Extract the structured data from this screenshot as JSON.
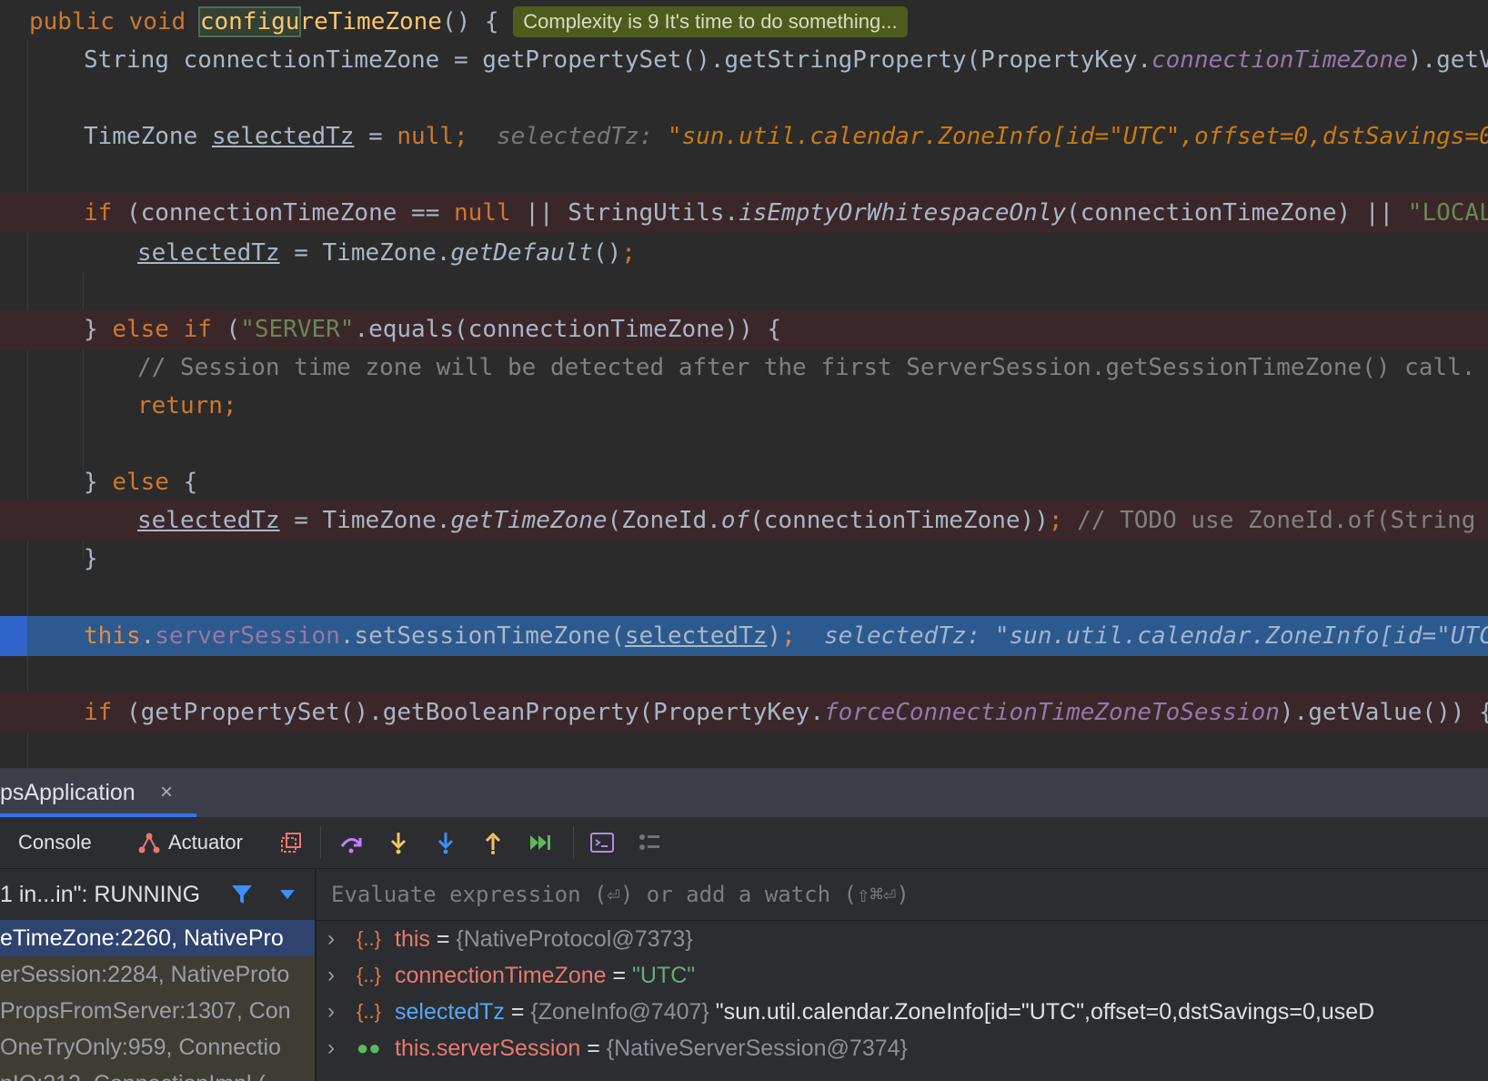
{
  "editor": {
    "complexity_badge": "Complexity is 9 It's time to do something...",
    "l1": {
      "kw": "public void ",
      "caret_word": "configu",
      "fn_rest": "reTimeZone",
      "tail": "() {"
    },
    "l2": {
      "a": "String connectionTimeZone = getPropertySet().getStringProperty(PropertyKey.",
      "fld": "connectionTimeZone",
      "b": ").getV"
    },
    "l3": {
      "a": "TimeZone ",
      "var": "selectedTz",
      "b": " = ",
      "kw": "null;",
      "hint_label": "selectedTz:",
      "hint_value": "\"sun.util.calendar.ZoneInfo[id=\"UTC\",offset=0,dstSavings=0"
    },
    "l4": {
      "kw": "if ",
      "a": "(connectionTimeZone == ",
      "kw2": "null",
      "b": " || StringUtils.",
      "st": "isEmptyOrWhitespaceOnly",
      "c": "(connectionTimeZone) || ",
      "str": "\"LOCAL"
    },
    "l5": {
      "var": "selectedTz",
      "a": " = TimeZone.",
      "st": "getDefault",
      "b": "()",
      "kw": ";"
    },
    "l6": {
      "a": "} ",
      "kw": "else if ",
      "b": "(",
      "str": "\"SERVER\"",
      "c": ".equals(connectionTimeZone)) {"
    },
    "l7": {
      "cm": "// Session time zone will be detected after the first ServerSession.getSessionTimeZone() call."
    },
    "l8": {
      "kw": "return;"
    },
    "l9": {
      "a": "} ",
      "kw": "else",
      "b": " {"
    },
    "l10": {
      "var": "selectedTz",
      "a": " = TimeZone.",
      "st": "getTimeZone",
      "b": "(ZoneId.",
      "st2": "of",
      "c": "(connectionTimeZone))",
      "kw": ";",
      "cm": " // TODO use ZoneId.of(String"
    },
    "l11": {
      "a": "}"
    },
    "l12": {
      "kw": "this",
      "a": ".",
      "fld": "serverSession",
      "b": ".setSessionTimeZone(",
      "var": "selectedTz",
      "c": ")",
      "kw2": ";",
      "hint_label": "selectedTz:",
      "hint_value": "\"sun.util.calendar.ZoneInfo[id=\"UTC"
    },
    "l13": {
      "kw": "if ",
      "a": "(getPropertySet().getBooleanProperty(PropertyKey.",
      "fld": "forceConnectionTimeZoneToSession",
      "b": ").getValue()) {"
    }
  },
  "debug": {
    "tab_label": "psApplication",
    "tab_close": "×",
    "toolbar": {
      "console": "Console",
      "actuator": "Actuator"
    },
    "thread_status": "1 in...in\": RUNNING",
    "frames": [
      "eTimeZone:2260, NativePro",
      "erSession:2284, NativeProto",
      "PropsFromServer:1307, Con",
      "OneTryOnly:959, Connectio",
      "nIO:212, ConnectionImpl ("
    ],
    "eval_placeholder": "Evaluate expression (⏎) or add a watch (⇧⌘⏎)",
    "vars": [
      {
        "name": "this",
        "eq": " = ",
        "type": "{NativeProtocol@7373}",
        "value": ""
      },
      {
        "name": "connectionTimeZone",
        "eq": " = ",
        "type": "",
        "value": "\"UTC\""
      },
      {
        "name": "selectedTz",
        "eq": " = ",
        "type": "{ZoneInfo@7407}",
        "value": " \"sun.util.calendar.ZoneInfo[id=\"UTC\",offset=0,dstSavings=0,useD"
      },
      {
        "name": "this.serverSession",
        "eq": " = ",
        "type": "{NativeServerSession@7374}",
        "value": ""
      }
    ]
  },
  "colors": {
    "accent": "#3574f0",
    "breakpoint_line": "#3b2729",
    "current_line": "#2d5a8e",
    "badge": "#4d5c1d"
  }
}
